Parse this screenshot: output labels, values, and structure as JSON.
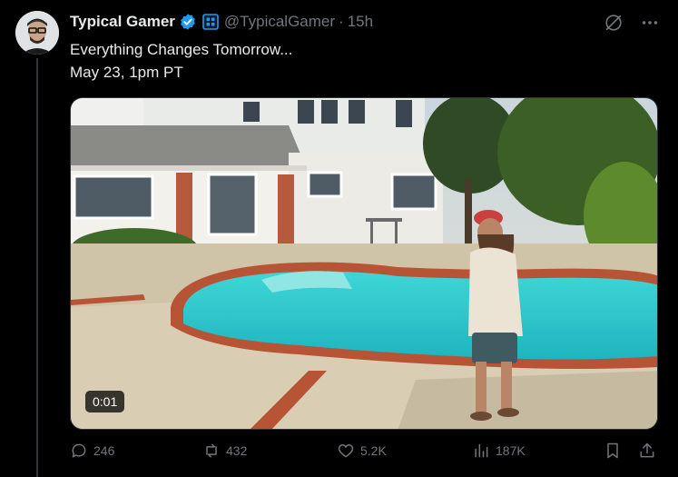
{
  "tweet": {
    "author_name": "Typical Gamer",
    "handle": "@TypicalGamer",
    "separator": "·",
    "time": "15h",
    "text_line1": "Everything Changes Tomorrow...",
    "text_line2": "May 23, 1pm PT",
    "video_duration": "0:01"
  },
  "actions": {
    "replies": "246",
    "reposts": "432",
    "likes": "5.2K",
    "views": "187K"
  },
  "icons": {
    "verified": "verified-badge-icon",
    "affiliate": "affiliate-badge-icon",
    "grok": "grok-icon",
    "more": "more-icon",
    "reply": "reply-icon",
    "repost": "repost-icon",
    "like": "heart-icon",
    "views": "views-icon",
    "bookmark": "bookmark-icon",
    "share": "share-icon"
  },
  "colors": {
    "background": "#000000",
    "text": "#e7e9ea",
    "muted": "#71767b",
    "verified": "#1d9bf0"
  }
}
